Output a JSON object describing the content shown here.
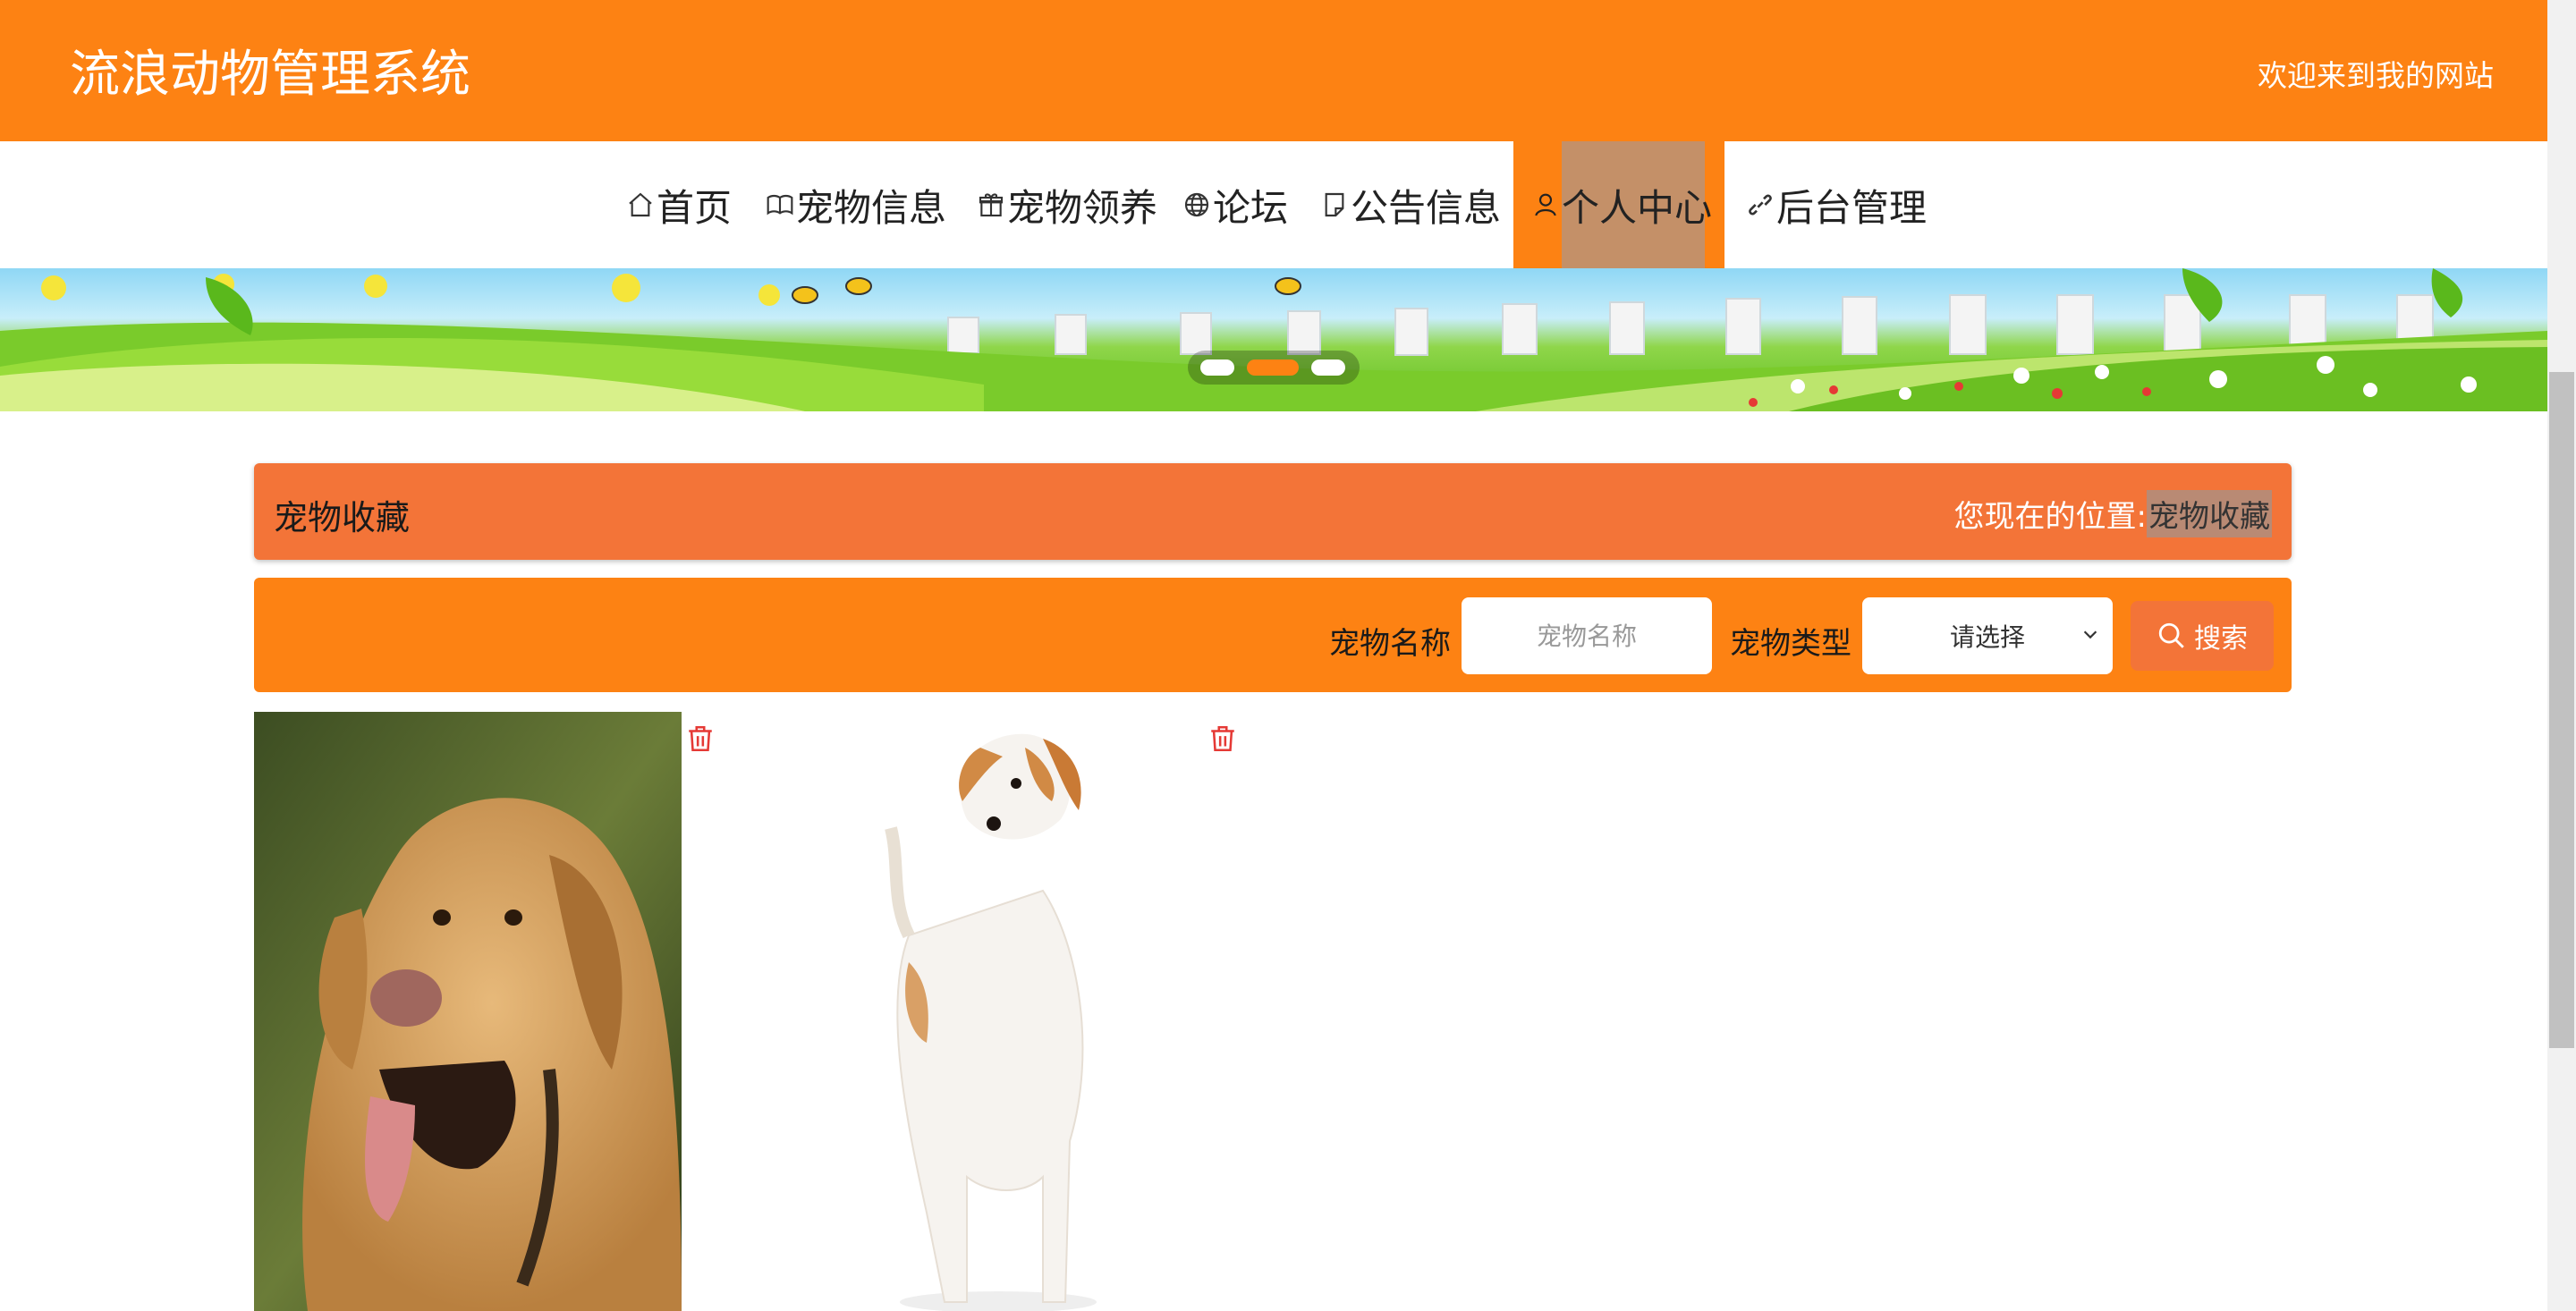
{
  "header": {
    "title": "流浪动物管理系统",
    "welcome": "欢迎来到我的网站"
  },
  "nav": {
    "items": [
      {
        "label": "首页",
        "icon": "home-icon"
      },
      {
        "label": "宠物信息",
        "icon": "book-icon"
      },
      {
        "label": "宠物领养",
        "icon": "gift-icon"
      },
      {
        "label": "论坛",
        "icon": "globe-icon"
      },
      {
        "label": "公告信息",
        "icon": "note-icon"
      },
      {
        "label": "个人中心",
        "icon": "user-icon",
        "active": true
      },
      {
        "label": "后台管理",
        "icon": "link-icon"
      }
    ]
  },
  "banner": {
    "active_slide": 2,
    "slide_count": 3
  },
  "breadcrumb": {
    "title": "宠物收藏",
    "location_label": "您现在的位置:",
    "current": "宠物收藏"
  },
  "search": {
    "name_label": "宠物名称",
    "name_placeholder": "宠物名称",
    "type_label": "宠物类型",
    "type_selected": "请选择",
    "button_label": "搜索"
  },
  "colors": {
    "primary": "#fd8213",
    "accent": "#f37438",
    "active_nav": "#c49068",
    "delete": "#e53935"
  },
  "favorites": [
    {
      "image": "golden-retriever",
      "delete_icon": "trash-icon"
    },
    {
      "image": "jack-russell-terrier",
      "delete_icon": "trash-icon"
    }
  ]
}
